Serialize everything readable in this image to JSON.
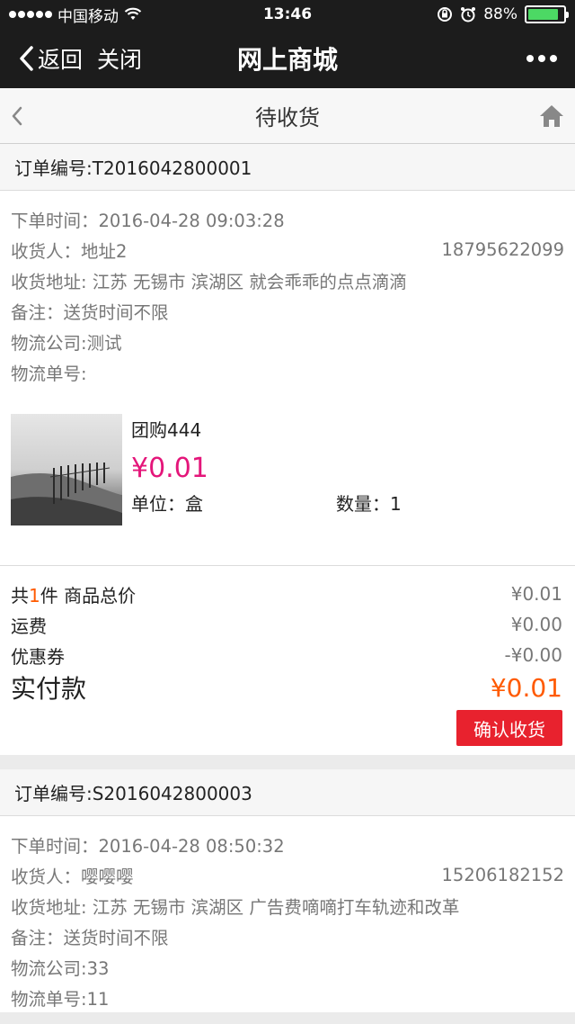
{
  "status_bar": {
    "carrier": "中国移动",
    "time": "13:46",
    "battery_percent": "88%",
    "battery_level": 0.88,
    "icons": [
      "signal-dots-icon",
      "wifi-icon",
      "rotation-lock-icon",
      "alarm-icon",
      "battery-icon"
    ]
  },
  "nav": {
    "back_label": "返回",
    "close_label": "关闭",
    "title": "网上商城",
    "more_icon": "more-dots-icon"
  },
  "page_header": {
    "title": "待收货",
    "back_icon": "chevron-left-icon",
    "home_icon": "home-icon"
  },
  "orders": [
    {
      "order_no": "订单编号:T2016042800001",
      "order_time": "下单时间：2016-04-28 09:03:28",
      "receiver": "收货人：地址2",
      "phone": "18795622099",
      "address": "收货地址: 江苏 无锡市 滨湖区 就会乖乖的点点滴滴",
      "remark": "备注：送货时间不限",
      "logistics_company": "物流公司:测试",
      "tracking_no": "物流单号:",
      "product": {
        "name": "团购444",
        "price": "¥0.01",
        "unit": "单位：盒",
        "quantity": "数量：1"
      },
      "summary": {
        "count_prefix": "共",
        "count": "1",
        "count_suffix": "件 商品总价",
        "goods_total": "¥0.01",
        "shipping_label": "运费",
        "shipping": "¥0.00",
        "coupon_label": "优惠券",
        "coupon": "-¥0.00",
        "paid_label": "实付款",
        "paid": "¥0.01"
      },
      "confirm_button": "确认收货"
    },
    {
      "order_no": "订单编号:S2016042800003",
      "order_time": "下单时间：2016-04-28 08:50:32",
      "receiver": "收货人：嘤嘤嘤",
      "phone": "15206182152",
      "address": "收货地址: 江苏 无锡市 滨湖区 广告费嘀嘀打车轨迹和改革",
      "remark": "备注：送货时间不限",
      "logistics_company": "物流公司:33",
      "tracking_no": "物流单号:11"
    }
  ],
  "colors": {
    "bar_background": "#1c1c1c",
    "price_pink": "#e4167a",
    "accent_orange": "#ff5a00",
    "button_red": "#e8222e"
  }
}
